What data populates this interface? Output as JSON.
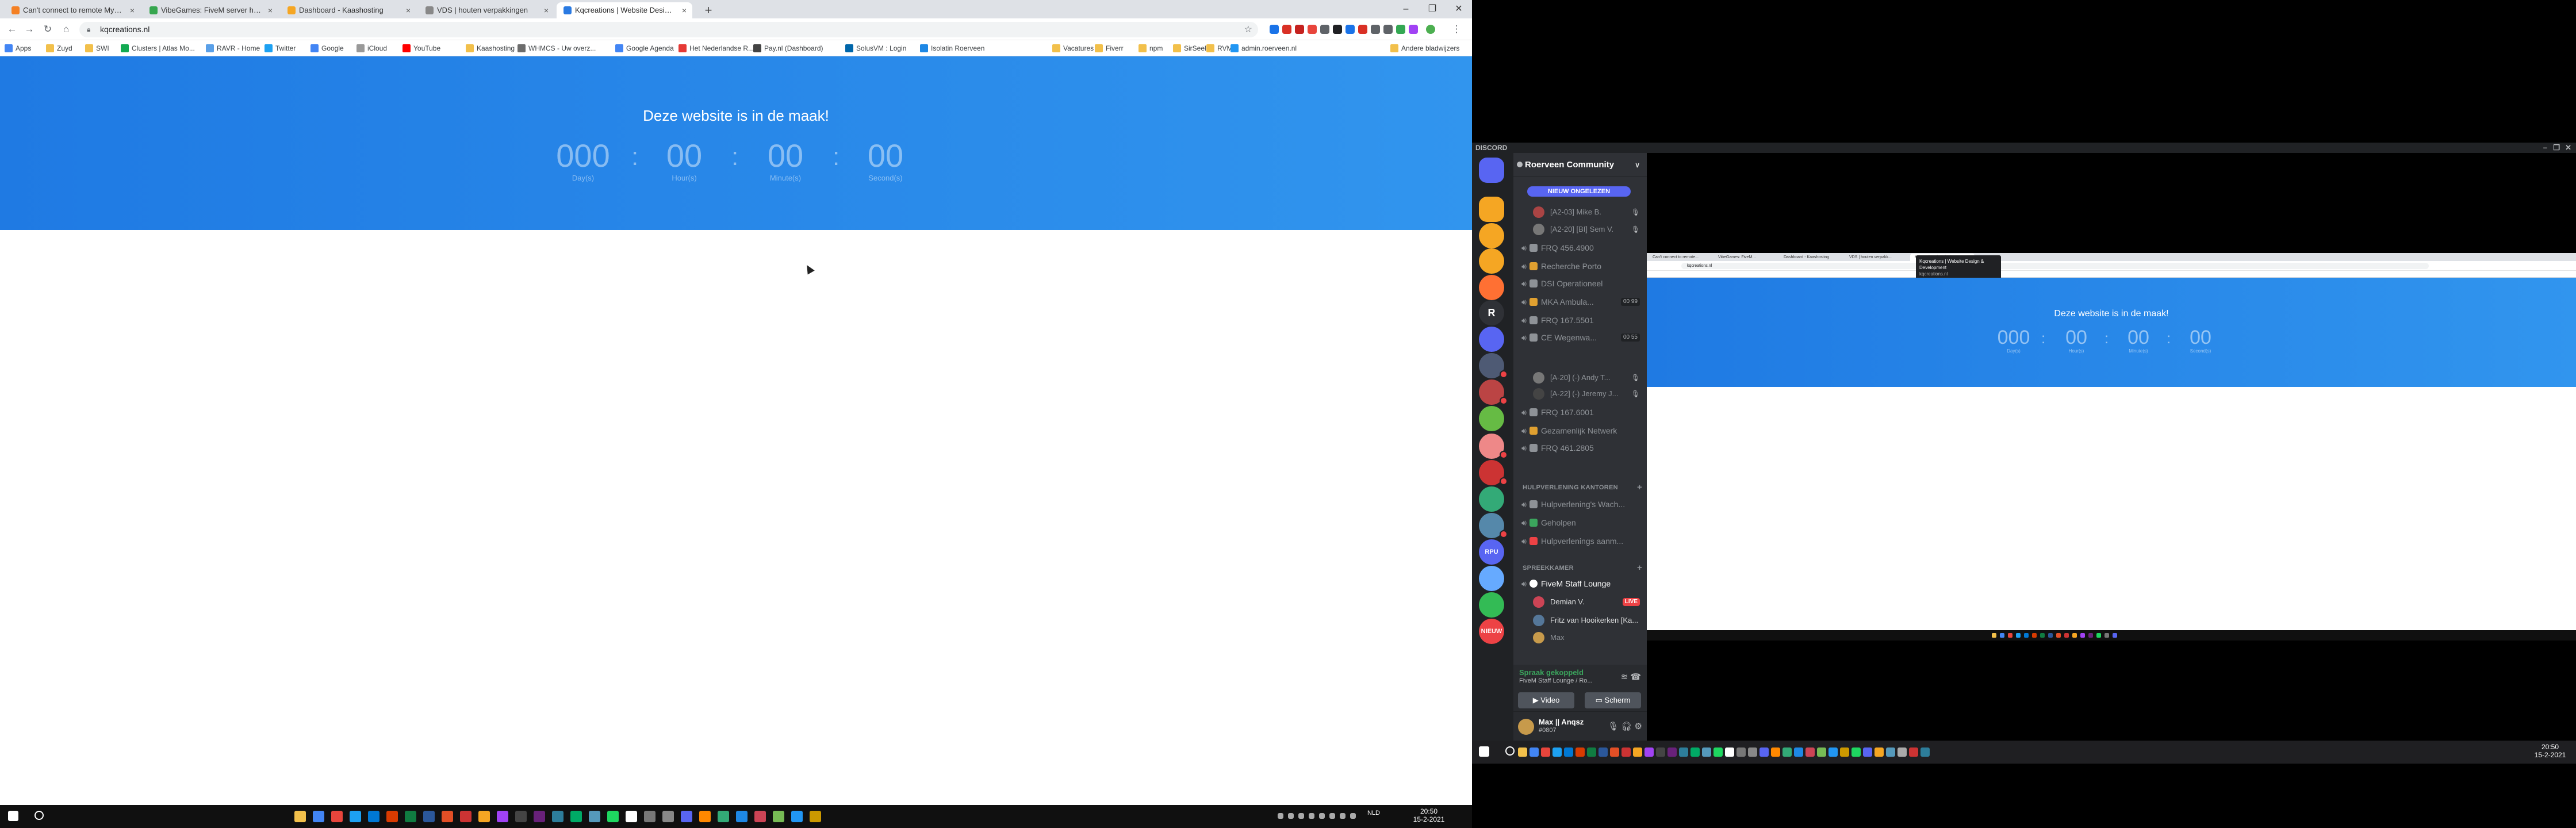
{
  "browser": {
    "tabs": [
      {
        "title": "Can't connect to remote MySQL...",
        "color": "#f48024"
      },
      {
        "title": "VibeGames: FiveM server hosting...",
        "color": "#36a64f"
      },
      {
        "title": "Dashboard - Kaashosting",
        "color": "#f5a623"
      },
      {
        "title": "VDS | houten verpakkingen",
        "color": "#888888"
      },
      {
        "title": "Kqcreations | Website Design &...",
        "color": "#2a7ae2"
      }
    ],
    "url": "kqcreations.nl",
    "bookmarks": [
      {
        "label": "Apps",
        "color": "#4285f4"
      },
      {
        "label": "Zuyd",
        "color": "#f2c04b"
      },
      {
        "label": "SWI",
        "color": "#f2c04b"
      },
      {
        "label": "Clusters | Atlas Mo...",
        "color": "#13aa52"
      },
      {
        "label": "RAVR - Home",
        "color": "#5aa0e8"
      },
      {
        "label": "Twitter",
        "color": "#1da1f2"
      },
      {
        "label": "Google",
        "color": "#4285f4"
      },
      {
        "label": "iCloud",
        "color": "#999999"
      },
      {
        "label": "YouTube",
        "color": "#ff0000"
      },
      {
        "label": "Kaashosting",
        "color": "#f2c04b"
      },
      {
        "label": "WHMCS - Uw overz...",
        "color": "#6c6c6c"
      },
      {
        "label": "Google Agenda",
        "color": "#4285f4"
      },
      {
        "label": "Het Nederlandse R...",
        "color": "#e53935"
      },
      {
        "label": "Pay.nl (Dashboard)",
        "color": "#444444"
      },
      {
        "label": "SolusVM : Login",
        "color": "#0066aa"
      },
      {
        "label": "Isolatin Roerveen",
        "color": "#1e88e5"
      },
      {
        "label": "Vacatures",
        "color": "#f2c04b"
      },
      {
        "label": "Fiverr",
        "color": "#f2c04b"
      },
      {
        "label": "npm",
        "color": "#f2c04b"
      },
      {
        "label": "SirSeeld",
        "color": "#f2c04b"
      },
      {
        "label": "RVMC",
        "color": "#f2c04b"
      },
      {
        "label": "admin.roerveen.nl",
        "color": "#2196f3"
      },
      {
        "label": "Andere bladwijzers",
        "color": "#f2c04b"
      }
    ]
  },
  "hero": {
    "title": "Deze website is in de maak!",
    "countdown": [
      {
        "value": "000",
        "unit": "Day(s)"
      },
      {
        "value": "00",
        "unit": "Hour(s)"
      },
      {
        "value": "00",
        "unit": "Minute(s)"
      },
      {
        "value": "00",
        "unit": "Second(s)"
      }
    ],
    "separator": ":"
  },
  "taskbar_left": {
    "clock_time": "20:50",
    "clock_date": "15-2-2021",
    "lang": "NLD"
  },
  "discord": {
    "app_title": "DISCORD",
    "server_name": "Roerveen Community",
    "unread_label": "NIEUW ONGELEZEN",
    "top_users": [
      {
        "name": "[A2-03] Mike B.",
        "color": "#a44"
      },
      {
        "name": "[A2-20] [BI] Sem V.",
        "color": "#777"
      }
    ],
    "channels": [
      {
        "name": "FRQ 456.4900",
        "emoji_color": "#8e9297"
      },
      {
        "name": "Recherche Porto",
        "emoji_color": "#e0a030"
      },
      {
        "name": "DSI Operationeel",
        "emoji_color": "#8e9297"
      },
      {
        "name": "MKA Ambula...",
        "emoji_color": "#e0a030",
        "cap": "00 99"
      },
      {
        "name": "FRQ 167.5501",
        "emoji_color": "#8e9297"
      },
      {
        "name": "CE Wegenwa...",
        "emoji_color": "#8e9297",
        "cap": "00 55"
      }
    ],
    "sub_users": [
      {
        "name": "[A-20] (-) Andy T...",
        "color": "#777"
      },
      {
        "name": "[A-22] (-) Jeremy J...",
        "color": "#444"
      }
    ],
    "channels2": [
      {
        "name": "FRQ 167.6001",
        "emoji_color": "#8e9297"
      },
      {
        "name": "Gezamenlijk Netwerk",
        "emoji_color": "#e0a030"
      },
      {
        "name": "FRQ 461.2805",
        "emoji_color": "#8e9297"
      }
    ],
    "cat1": "HULPVERLENING KANTOREN",
    "cat1_channels": [
      {
        "name": "Hulpverlening's Wach...",
        "emoji_color": "#8e9297"
      },
      {
        "name": "Geholpen",
        "emoji_color": "#3ba55d"
      },
      {
        "name": "Hulpverlenings aanm...",
        "emoji_color": "#ed4245"
      }
    ],
    "cat2": "SPREEKKAMER",
    "lounge": "FiveM Staff Lounge",
    "lounge_users": [
      {
        "name": "Demian V.",
        "color": "#c45",
        "live": "LIVE"
      },
      {
        "name": "Fritz van Hooikerken [Ka...",
        "color": "#579"
      },
      {
        "name": "Max",
        "color": "#c79a4b"
      }
    ],
    "voice_status": "Spraak gekoppeld",
    "voice_sub": "FiveM Staff Lounge / Ro...",
    "video_btn": "Video",
    "screen_btn": "Scherm",
    "user_name": "Max || Anqsz",
    "user_tag": "#0807",
    "guilds": [
      {
        "label": "",
        "color": "#5865f2"
      },
      {
        "label": "",
        "color": "#f5a623"
      },
      {
        "label": "",
        "color": "#f5a623"
      },
      {
        "label": "",
        "color": "#f5a623"
      },
      {
        "label": "",
        "color": "#ff7033"
      },
      {
        "label": "R",
        "color": "#2f3136"
      },
      {
        "label": "",
        "color": "#5865f2"
      },
      {
        "label": "",
        "color": "#4e5a74"
      },
      {
        "label": "",
        "color": "#b44"
      },
      {
        "label": "",
        "color": "#6b4"
      },
      {
        "label": "",
        "color": "#e88"
      },
      {
        "label": "",
        "color": "#c33"
      },
      {
        "label": "",
        "color": "#3a7"
      },
      {
        "label": "",
        "color": "#58a"
      },
      {
        "label": "RPU",
        "color": "#5865f2"
      },
      {
        "label": "",
        "color": "#6af"
      },
      {
        "label": "",
        "color": "#3b5"
      },
      {
        "label": "NIEUW",
        "color": "#ed4245"
      }
    ]
  },
  "stream": {
    "tabs": [
      "Can't connect to remote...",
      "VibeGames: FiveM...",
      "Dashboard - Kaashosting",
      "VDS | houten verpakk...",
      "Kqcreations | Website D..."
    ],
    "url": "kqcreations.nl",
    "tooltip_title": "Kqcreations | Website Design & Development",
    "tooltip_url": "kqcreations.nl",
    "title": "Deze website is in de maak!",
    "countdown": [
      {
        "value": "000",
        "unit": "Day(s)"
      },
      {
        "value": "00",
        "unit": "Hour(s)"
      },
      {
        "value": "00",
        "unit": "Minute(s)"
      },
      {
        "value": "00",
        "unit": "Second(s)"
      }
    ],
    "separator": ":"
  },
  "taskbar_right": {
    "clock_time": "20:50",
    "clock_date": "15-2-2021"
  }
}
